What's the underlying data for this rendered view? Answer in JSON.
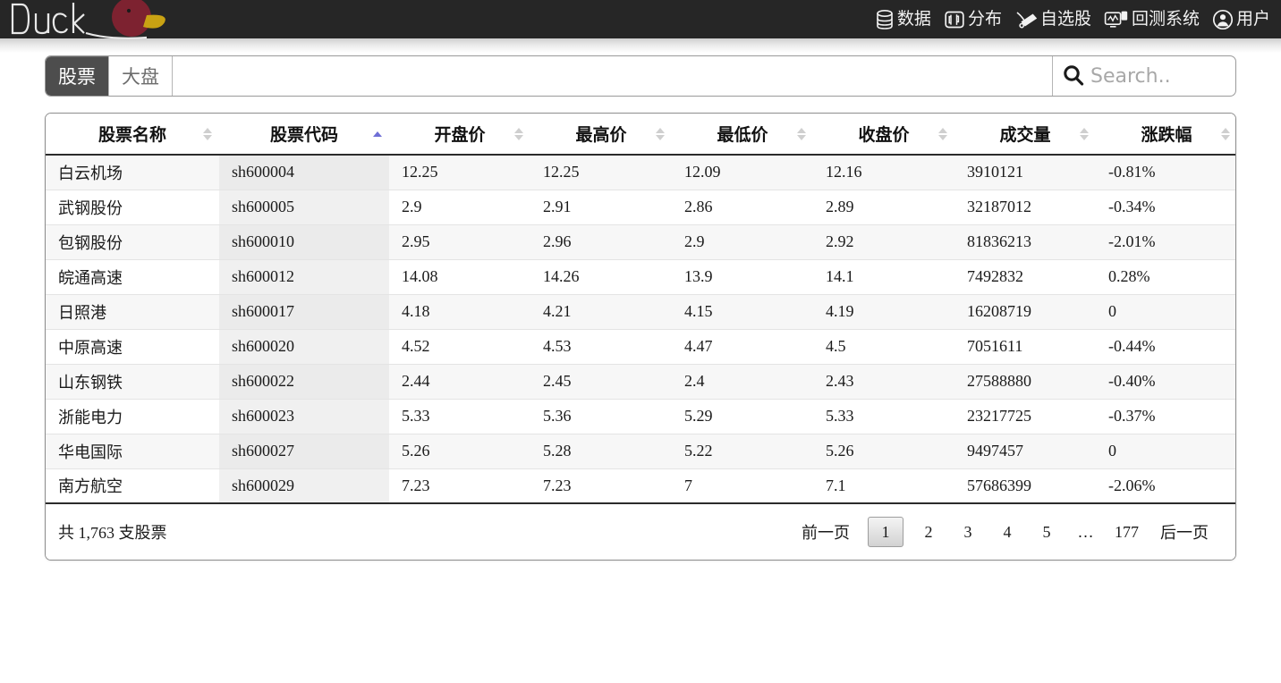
{
  "brand": {
    "name": "Duck",
    "logo_icon": "duck-logo"
  },
  "nav": {
    "items": [
      {
        "label": "数据",
        "icon": "database-icon"
      },
      {
        "label": "分布",
        "icon": "distribution-chart-icon"
      },
      {
        "label": "自选股",
        "icon": "watchlist-icon"
      },
      {
        "label": "回测系统",
        "icon": "backtest-monitor-icon"
      },
      {
        "label": "用户",
        "icon": "user-icon"
      }
    ]
  },
  "search": {
    "tabs": [
      {
        "label": "股票",
        "active": true
      },
      {
        "label": "大盘",
        "active": false
      }
    ],
    "query_value": "",
    "query_placeholder": "",
    "box_value": "",
    "box_placeholder": "Search..",
    "search_icon": "magnifier-icon"
  },
  "table": {
    "columns": [
      {
        "label": "股票名称",
        "sort": "none"
      },
      {
        "label": "股票代码",
        "sort": "asc"
      },
      {
        "label": "开盘价",
        "sort": "none"
      },
      {
        "label": "最高价",
        "sort": "none"
      },
      {
        "label": "最低价",
        "sort": "none"
      },
      {
        "label": "收盘价",
        "sort": "none"
      },
      {
        "label": "成交量",
        "sort": "none"
      },
      {
        "label": "涨跌幅",
        "sort": "none"
      }
    ],
    "rows": [
      {
        "name": "白云机场",
        "code": "sh600004",
        "open": "12.25",
        "high": "12.25",
        "low": "12.09",
        "close": "12.16",
        "volume": "3910121",
        "change": "-0.81%",
        "dir": "down"
      },
      {
        "name": "武钢股份",
        "code": "sh600005",
        "open": "2.9",
        "high": "2.91",
        "low": "2.86",
        "close": "2.89",
        "volume": "32187012",
        "change": "-0.34%",
        "dir": "down"
      },
      {
        "name": "包钢股份",
        "code": "sh600010",
        "open": "2.95",
        "high": "2.96",
        "low": "2.9",
        "close": "2.92",
        "volume": "81836213",
        "change": "-2.01%",
        "dir": "down"
      },
      {
        "name": "皖通高速",
        "code": "sh600012",
        "open": "14.08",
        "high": "14.26",
        "low": "13.9",
        "close": "14.1",
        "volume": "7492832",
        "change": "0.28%",
        "dir": "up"
      },
      {
        "name": "日照港",
        "code": "sh600017",
        "open": "4.18",
        "high": "4.21",
        "low": "4.15",
        "close": "4.19",
        "volume": "16208719",
        "change": "0",
        "dir": "flat"
      },
      {
        "name": "中原高速",
        "code": "sh600020",
        "open": "4.52",
        "high": "4.53",
        "low": "4.47",
        "close": "4.5",
        "volume": "7051611",
        "change": "-0.44%",
        "dir": "down"
      },
      {
        "name": "山东钢铁",
        "code": "sh600022",
        "open": "2.44",
        "high": "2.45",
        "low": "2.4",
        "close": "2.43",
        "volume": "27588880",
        "change": "-0.40%",
        "dir": "down"
      },
      {
        "name": "浙能电力",
        "code": "sh600023",
        "open": "5.33",
        "high": "5.36",
        "low": "5.29",
        "close": "5.33",
        "volume": "23217725",
        "change": "-0.37%",
        "dir": "down"
      },
      {
        "name": "华电国际",
        "code": "sh600027",
        "open": "5.26",
        "high": "5.28",
        "low": "5.22",
        "close": "5.26",
        "volume": "9497457",
        "change": "0",
        "dir": "flat"
      },
      {
        "name": "南方航空",
        "code": "sh600029",
        "open": "7.23",
        "high": "7.23",
        "low": "7",
        "close": "7.1",
        "volume": "57686399",
        "change": "-2.06%",
        "dir": "down"
      }
    ]
  },
  "footer": {
    "total_text": "共 1,763 支股票",
    "prev_label": "前一页",
    "next_label": "后一页",
    "pages": [
      "1",
      "2",
      "3",
      "4",
      "5",
      "…",
      "177"
    ],
    "current_page": "1"
  },
  "colors": {
    "topbar_bg": "#262626",
    "tab_active_bg": "#4d4d4d",
    "sort_active": "#6f6fd6",
    "down": "#1a8f28",
    "up": "#ee0000"
  }
}
